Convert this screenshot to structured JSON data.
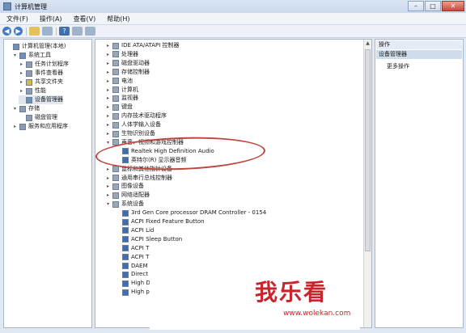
{
  "window": {
    "title": "计算机管理"
  },
  "menubar": [
    "文件(F)",
    "操作(A)",
    "查看(V)",
    "帮助(H)"
  ],
  "left_tree": [
    {
      "label": "计算机管理(本地)",
      "level": 0,
      "exp": "",
      "color": "#6f8fb8"
    },
    {
      "label": "系统工具",
      "level": 1,
      "exp": "▾",
      "color": "#6f8fb8"
    },
    {
      "label": "任务计划程序",
      "level": 2,
      "exp": "▸",
      "color": "#8b9bb0"
    },
    {
      "label": "事件查看器",
      "level": 2,
      "exp": "▸",
      "color": "#8b9bb0"
    },
    {
      "label": "共享文件夹",
      "level": 2,
      "exp": "▸",
      "color": "#d9b44a"
    },
    {
      "label": "性能",
      "level": 2,
      "exp": "▸",
      "color": "#8b9bb0"
    },
    {
      "label": "设备管理器",
      "level": 2,
      "exp": "",
      "color": "#6f8fb8"
    },
    {
      "label": "存储",
      "level": 1,
      "exp": "▾",
      "color": "#8b9bb0"
    },
    {
      "label": "磁盘管理",
      "level": 2,
      "exp": "",
      "color": "#8b9bb0"
    },
    {
      "label": "服务和应用程序",
      "level": 1,
      "exp": "▸",
      "color": "#8b9bb0"
    }
  ],
  "device_tree": [
    {
      "label": "IDE ATA/ATAPI 控制器",
      "level": 1,
      "exp": "▸"
    },
    {
      "label": "处理器",
      "level": 1,
      "exp": "▸"
    },
    {
      "label": "磁盘驱动器",
      "level": 1,
      "exp": "▸"
    },
    {
      "label": "存储控制器",
      "level": 1,
      "exp": "▸"
    },
    {
      "label": "电池",
      "level": 1,
      "exp": "▸"
    },
    {
      "label": "计算机",
      "level": 1,
      "exp": "▸"
    },
    {
      "label": "监视器",
      "level": 1,
      "exp": "▸"
    },
    {
      "label": "键盘",
      "level": 1,
      "exp": "▸"
    },
    {
      "label": "内存技术驱动程序",
      "level": 1,
      "exp": "▸"
    },
    {
      "label": "人体学输入设备",
      "level": 1,
      "exp": "▸"
    },
    {
      "label": "生物识别设备",
      "level": 1,
      "exp": "▸"
    },
    {
      "label": "声音、视频和游戏控制器",
      "level": 1,
      "exp": "▾"
    },
    {
      "label": "Realtek High Definition Audio",
      "level": 2,
      "exp": ""
    },
    {
      "label": "英特尔(R) 显示器音频",
      "level": 2,
      "exp": ""
    },
    {
      "label": "鼠标和其他指针设备",
      "level": 1,
      "exp": "▸"
    },
    {
      "label": "通用串行总线控制器",
      "level": 1,
      "exp": "▸"
    },
    {
      "label": "图像设备",
      "level": 1,
      "exp": "▸"
    },
    {
      "label": "网络适配器",
      "level": 1,
      "exp": "▸"
    },
    {
      "label": "系统设备",
      "level": 1,
      "exp": "▾"
    },
    {
      "label": "3rd Gen Core processor DRAM Controller - 0154",
      "level": 2,
      "exp": ""
    },
    {
      "label": "ACPI Fixed Feature Button",
      "level": 2,
      "exp": ""
    },
    {
      "label": "ACPI Lid",
      "level": 2,
      "exp": ""
    },
    {
      "label": "ACPI Sleep Button",
      "level": 2,
      "exp": ""
    },
    {
      "label": "ACPI T",
      "level": 2,
      "exp": ""
    },
    {
      "label": "ACPI T",
      "level": 2,
      "exp": ""
    },
    {
      "label": "DAEM",
      "level": 2,
      "exp": ""
    },
    {
      "label": "Direct",
      "level": 2,
      "exp": ""
    },
    {
      "label": "High D",
      "level": 2,
      "exp": ""
    },
    {
      "label": "High p",
      "level": 2,
      "exp": ""
    }
  ],
  "right_pane": {
    "header": "操作",
    "section": "设备管理器",
    "more_actions": "更多操作"
  },
  "watermark": {
    "logo": "我乐看",
    "url": "www.wolekan.com"
  },
  "colors": {
    "highlight": "#c0443d",
    "watermark": "#c8242d",
    "device_icon": "#3f6fb3"
  }
}
